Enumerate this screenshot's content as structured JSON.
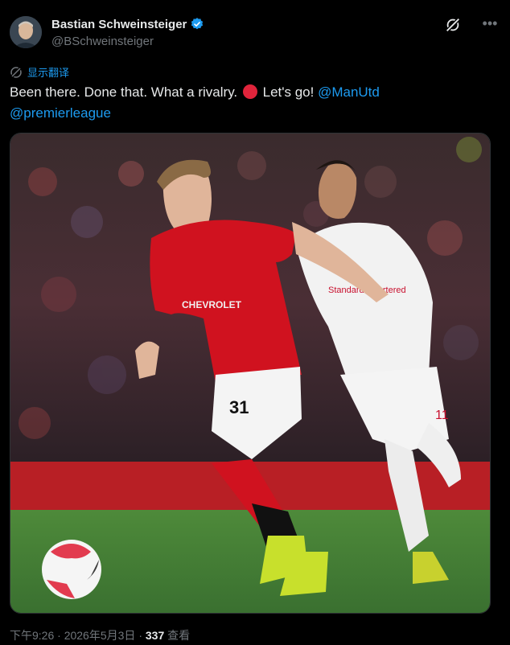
{
  "author": {
    "display_name": "Bastian Schweinsteiger",
    "handle": "@BSchweinsteiger"
  },
  "translate_label": "显示翻译",
  "tweet": {
    "text_part1": "Been there. Done that. What a rivalry. ",
    "text_part2": " Let's go! ",
    "mention1": "@ManUtd",
    "mention2": "@premierleague"
  },
  "photo": {
    "home_sponsor": "CHEVROLET",
    "home_number": "31",
    "away_sponsor": "Standard Chartered",
    "away_number": "11"
  },
  "meta": {
    "time": "下午9:26",
    "date": "2026年5月3日",
    "views_count": "337",
    "views_label": "查看"
  },
  "colors": {
    "accent": "#1d9bf0",
    "red_emoji": "#e0243b",
    "united_red": "#c8102e"
  },
  "icons": [
    "verified-badge-icon",
    "grok-icon",
    "more-icon",
    "translate-icon",
    "red-circle-emoji"
  ]
}
